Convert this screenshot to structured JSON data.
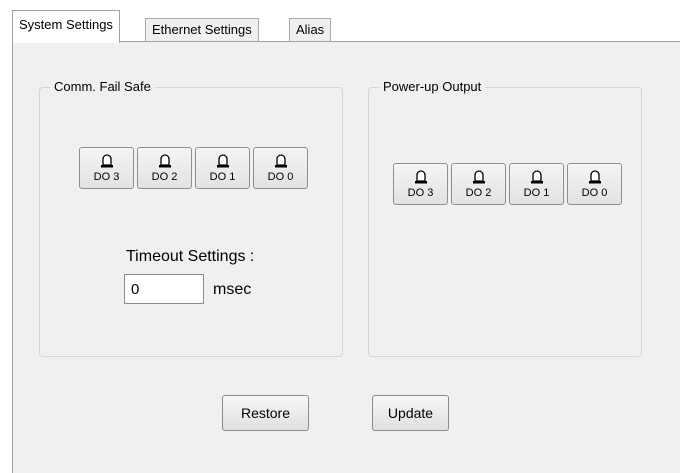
{
  "tabs": [
    {
      "label": "System Settings",
      "active": true
    },
    {
      "label": "Ethernet Settings",
      "active": false
    },
    {
      "label": "Alias",
      "active": false
    }
  ],
  "comm_fail_safe": {
    "title": "Comm. Fail Safe",
    "outputs": [
      "DO 3",
      "DO 2",
      "DO 1",
      "DO 0"
    ],
    "icon": "bell-icon",
    "timeout_label": "Timeout Settings :",
    "timeout_value": "0",
    "timeout_unit": "msec"
  },
  "power_up_output": {
    "title": "Power-up Output",
    "outputs": [
      "DO 3",
      "DO 2",
      "DO 1",
      "DO 0"
    ],
    "icon": "bell-icon"
  },
  "actions": {
    "restore_label": "Restore",
    "update_label": "Update"
  },
  "colors": {
    "panel_bg": "#f0f0f0",
    "border": "#a0a0a0"
  }
}
